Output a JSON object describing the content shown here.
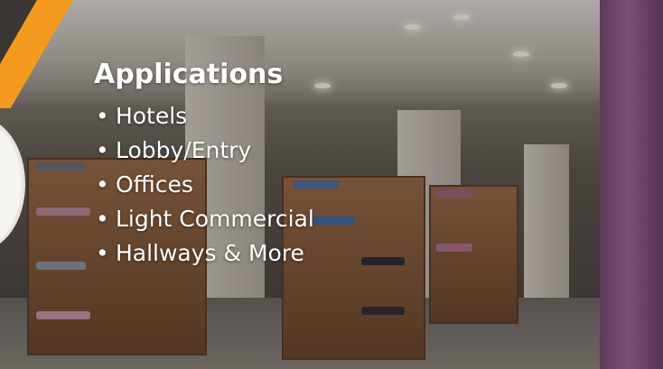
{
  "slide": {
    "heading": "Applications",
    "bullet_glyph": "•",
    "items": [
      {
        "label": "Hotels"
      },
      {
        "label": "Lobby/Entry"
      },
      {
        "label": "Offices"
      },
      {
        "label": "Light Commercial"
      },
      {
        "label": "Hallways & More"
      }
    ],
    "background": "retail clothing store interior photo",
    "accent_color": "#f39a1f",
    "text_color": "#ffffff"
  }
}
